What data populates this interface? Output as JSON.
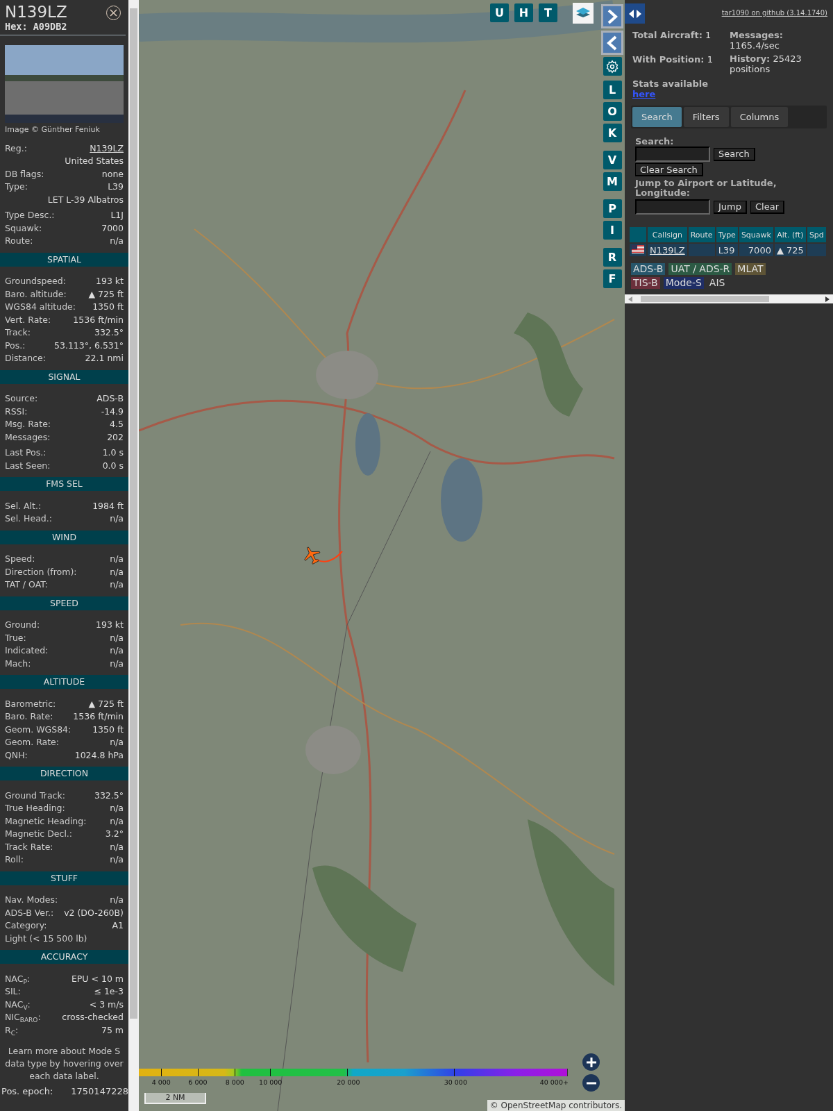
{
  "aircraft": {
    "title": "N139LZ",
    "hex": "Hex: A09DB2",
    "photo_credit": "Image © Günther Feniuk",
    "info_groups": [
      [
        {
          "kind": "link",
          "label": "Reg.:",
          "value": "N139LZ"
        },
        {
          "kind": "value",
          "value": "United States"
        },
        {
          "kind": "pair",
          "label": "DB flags:",
          "value": "none"
        },
        {
          "kind": "pair",
          "label": "Type:",
          "value": "L39"
        },
        {
          "kind": "value",
          "value": "LET L-39 Albatros"
        }
      ],
      [
        {
          "kind": "pair",
          "label": "Type Desc.:",
          "value": "L1J"
        },
        {
          "kind": "pair",
          "label": "Squawk:",
          "value": "7000"
        },
        {
          "kind": "pair",
          "label": "Route:",
          "value": "n/a"
        }
      ]
    ],
    "sections": [
      {
        "title": "SPATIAL",
        "groups": [
          [
            {
              "kind": "pair",
              "label": "Groundspeed:",
              "value": "193 kt"
            },
            {
              "kind": "pair",
              "label": "Baro. altitude:",
              "value": "▲ 725 ft"
            },
            {
              "kind": "pair",
              "label": "WGS84 altitude:",
              "value": "1350 ft"
            },
            {
              "kind": "pair",
              "label": "Vert. Rate:",
              "value": "1536 ft/min"
            },
            {
              "kind": "pair",
              "label": "Track:",
              "value": "332.5°"
            },
            {
              "kind": "pair",
              "label": "Pos.:",
              "value": "53.113°, 6.531°"
            },
            {
              "kind": "pair",
              "label": "Distance:",
              "value": "22.1 nmi"
            }
          ]
        ]
      },
      {
        "title": "SIGNAL",
        "groups": [
          [
            {
              "kind": "pair",
              "label": "Source:",
              "value": "ADS-B"
            },
            {
              "kind": "pair",
              "label": "RSSI:",
              "value": "-14.9"
            },
            {
              "kind": "pair",
              "label": "Msg. Rate:",
              "value": "4.5"
            },
            {
              "kind": "pair",
              "label": "Messages:",
              "value": "202"
            }
          ],
          [
            {
              "kind": "pair",
              "label": "Last Pos.:",
              "value": "1.0 s"
            },
            {
              "kind": "pair",
              "label": "Last Seen:",
              "value": "0.0 s"
            }
          ]
        ]
      },
      {
        "title": "FMS SEL",
        "groups": [
          [
            {
              "kind": "pair",
              "label": "Sel. Alt.:",
              "value": "1984 ft"
            },
            {
              "kind": "pair",
              "label": "Sel. Head.:",
              "value": "n/a"
            }
          ]
        ]
      },
      {
        "title": "WIND",
        "groups": [
          [
            {
              "kind": "pair",
              "label": "Speed:",
              "value": "n/a"
            },
            {
              "kind": "pair",
              "label": "Direction (from):",
              "value": "n/a"
            },
            {
              "kind": "pair",
              "label": "TAT / OAT:",
              "value": "n/a"
            }
          ]
        ]
      },
      {
        "title": "SPEED",
        "groups": [
          [
            {
              "kind": "pair",
              "label": "Ground:",
              "value": "193 kt"
            },
            {
              "kind": "pair",
              "label": "True:",
              "value": "n/a"
            },
            {
              "kind": "pair",
              "label": "Indicated:",
              "value": "n/a"
            },
            {
              "kind": "pair",
              "label": "Mach:",
              "value": "n/a"
            }
          ]
        ]
      },
      {
        "title": "ALTITUDE",
        "groups": [
          [
            {
              "kind": "pair",
              "label": "Barometric:",
              "value": "▲ 725 ft"
            },
            {
              "kind": "pair",
              "label": "Baro. Rate:",
              "value": "1536 ft/min"
            },
            {
              "kind": "pair",
              "label": "Geom. WGS84:",
              "value": "1350 ft"
            },
            {
              "kind": "pair",
              "label": "Geom. Rate:",
              "value": "n/a"
            },
            {
              "kind": "pair",
              "label": "QNH:",
              "value": "1024.8 hPa"
            }
          ]
        ]
      },
      {
        "title": "DIRECTION",
        "groups": [
          [
            {
              "kind": "pair",
              "label": "Ground Track:",
              "value": "332.5°"
            },
            {
              "kind": "pair",
              "label": "True Heading:",
              "value": "n/a"
            },
            {
              "kind": "pair",
              "label": "Magnetic Heading:",
              "value": "n/a"
            },
            {
              "kind": "pair",
              "label": "Magnetic Decl.:",
              "value": "3.2°"
            },
            {
              "kind": "pair",
              "label": "Track Rate:",
              "value": "n/a"
            },
            {
              "kind": "pair",
              "label": "Roll:",
              "value": "n/a"
            }
          ]
        ]
      },
      {
        "title": "STUFF",
        "groups": [
          [
            {
              "kind": "pair",
              "label": "Nav. Modes:",
              "value": "n/a"
            },
            {
              "kind": "pair",
              "label": "ADS-B Ver.:",
              "value": "v2 (DO-260B)"
            },
            {
              "kind": "pair",
              "label": "Category:",
              "value": "A1"
            },
            {
              "kind": "label",
              "label": "Light (< 15 500 lb)"
            }
          ]
        ]
      },
      {
        "title": "ACCURACY",
        "groups": [
          [
            {
              "kind": "pair",
              "label": "NAC$_{P}$:",
              "value": "EPU < 10 m"
            },
            {
              "kind": "pair",
              "label": "SIL:",
              "value": "≤ 1e-3"
            },
            {
              "kind": "pair",
              "label": "NAC$_{V}$:",
              "value": "< 3 m/s"
            },
            {
              "kind": "pair",
              "label": "NIC$_{BARO}$:",
              "value": "cross-checked"
            },
            {
              "kind": "pair",
              "label": "R$_{C}$:",
              "value": "75 m"
            }
          ]
        ]
      }
    ],
    "note": "Learn more about Mode S data type by hovering over each data label.",
    "epoch": {
      "label": "Pos. epoch:",
      "value": "1750147228"
    }
  },
  "map": {
    "top_buttons": [
      "U",
      "H",
      "T"
    ],
    "side_groups": [
      [
        "L",
        "O",
        "K"
      ],
      [
        "V",
        "M"
      ],
      [
        "P",
        "I"
      ],
      [
        "R",
        "F"
      ]
    ],
    "legend": [
      "4 000",
      "6 000",
      "8 000",
      "10 000",
      "20 000",
      "30 000",
      "40 000+"
    ],
    "scale": "2 NM",
    "attribution": {
      "prefix": "©",
      "link": "OpenStreetMap",
      "suffix": "contributors."
    }
  },
  "panel": {
    "github_link": "tar1090 on github (3.14.1740)",
    "stats_left": [
      {
        "kind": "pair",
        "label": "Total Aircraft:",
        "value": "1"
      },
      {
        "kind": "pair",
        "label": "With Position:",
        "value": "1"
      },
      {
        "kind": "link",
        "label": "Stats available",
        "value": "here"
      }
    ],
    "stats_right": [
      {
        "label": "Messages:",
        "value": "1165.4/sec"
      },
      {
        "label": "History:",
        "value": "25423 positions"
      }
    ],
    "tabs": [
      {
        "label": "Search",
        "selected": true
      },
      {
        "label": "Filters",
        "selected": false
      },
      {
        "label": "Columns",
        "selected": false
      }
    ],
    "search": {
      "label": "Search:",
      "button": "Search",
      "clear": "Clear Search"
    },
    "jump": {
      "label": "Jump to Airport or Latitude, Longitude:",
      "button": "Jump",
      "clear": "Clear"
    },
    "table": {
      "columns": [
        "Callsign",
        "Route",
        "Type",
        "Squawk",
        "Alt. (ft)",
        "Spd"
      ],
      "rows": [
        {
          "selected": true,
          "callsign": "N139LZ",
          "type": "L39",
          "squawk": "7000",
          "altitude": "▲ 725"
        }
      ]
    },
    "sources": [
      {
        "label": "ADS-B",
        "color": "#27566b"
      },
      {
        "label": "UAT / ADS-R",
        "color": "#2c5a44"
      },
      {
        "label": "MLAT",
        "color": "#5e5436"
      },
      {
        "label": "TIS-B",
        "color": "#6b2f3b"
      },
      {
        "label": "Mode-S",
        "color": "#1f2e66"
      },
      {
        "label": "AIS"
      }
    ]
  }
}
